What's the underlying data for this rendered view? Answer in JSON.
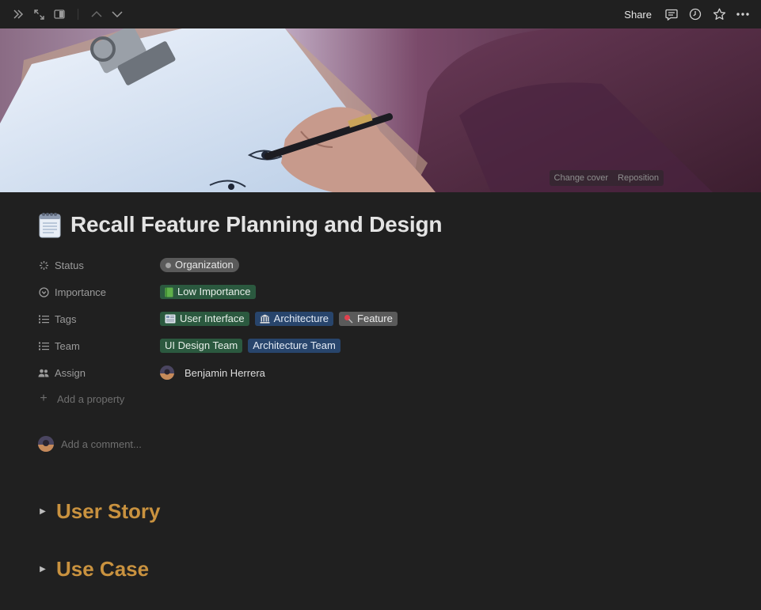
{
  "topbar": {
    "share_label": "Share",
    "icons": [
      "double-chevron-right-icon",
      "expand-icon",
      "side-peek-icon",
      "chevron-up-icon",
      "chevron-down-icon",
      "comment-icon",
      "history-icon",
      "star-icon",
      "more-icon"
    ]
  },
  "cover": {
    "change_cover_label": "Change cover",
    "reposition_label": "Reposition"
  },
  "page": {
    "icon": "notepad-icon",
    "title": "Recall Feature Planning and Design"
  },
  "properties": {
    "status": {
      "label": "Status",
      "value": "Organization"
    },
    "importance": {
      "label": "Importance",
      "value": "Low Importance"
    },
    "tags": {
      "label": "Tags",
      "values": [
        "User Interface",
        "Architecture",
        "Feature"
      ]
    },
    "team": {
      "label": "Team",
      "values": [
        "UI Design Team",
        "Architecture Team"
      ]
    },
    "assign": {
      "label": "Assign",
      "value": "Benjamin Herrera"
    },
    "add_property_label": "Add a property"
  },
  "comment": {
    "placeholder": "Add a comment..."
  },
  "sections": [
    {
      "heading": "User Story"
    },
    {
      "heading": "Use Case"
    }
  ],
  "colors": {
    "background": "#202020",
    "heading_accent": "#c9923f",
    "tag_green": "#2b593f",
    "tag_blue": "#28456c",
    "tag_gray": "#5a5a5a"
  }
}
